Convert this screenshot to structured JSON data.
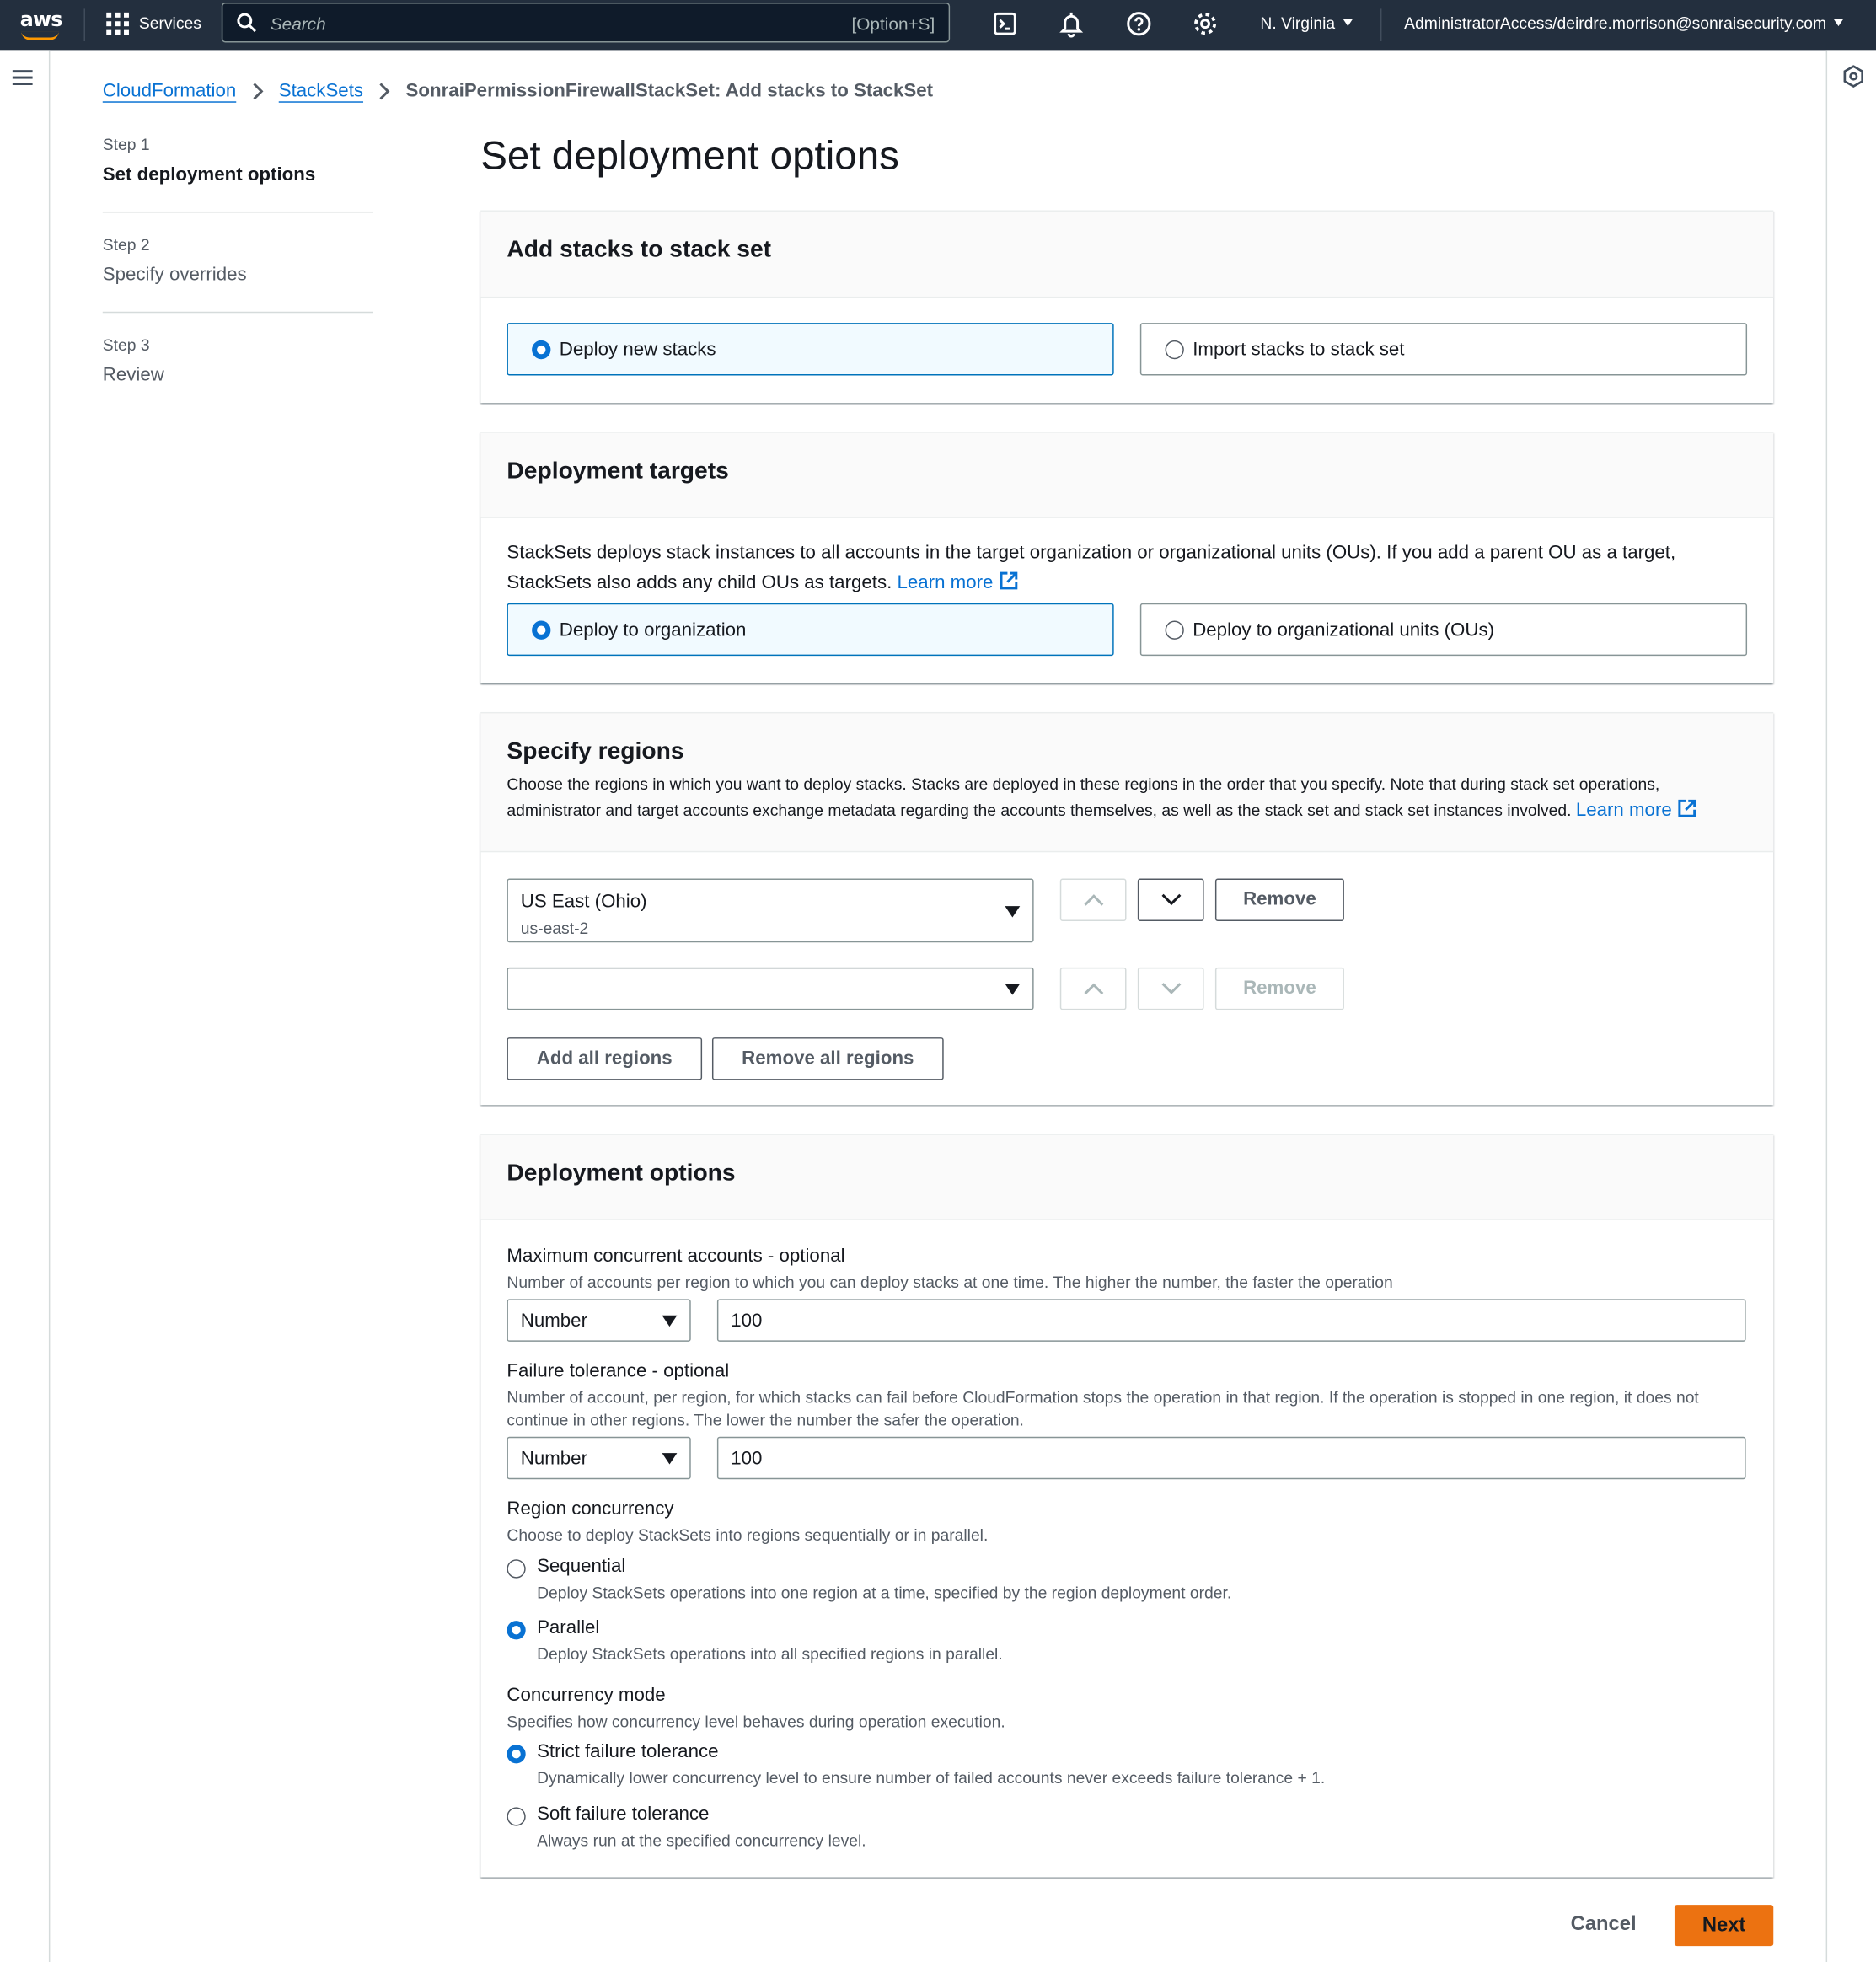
{
  "topnav": {
    "logo_text": "aws",
    "services_label": "Services",
    "search_placeholder": "Search",
    "search_shortcut": "[Option+S]",
    "region": "N. Virginia",
    "user": "AdministratorAccess/deirdre.morrison@sonraisecurity.com",
    "icons": [
      "cloudshell-icon",
      "bell-icon",
      "help-icon",
      "settings-icon"
    ],
    "accent_color": "#ff9900",
    "bg_color": "#232f3e"
  },
  "breadcrumb": {
    "items": [
      "CloudFormation",
      "StackSets"
    ],
    "current": "SonraiPermissionFirewallStackSet: Add stacks to StackSet"
  },
  "steps": [
    {
      "num": "Step 1",
      "name": "Set deployment options",
      "active": true
    },
    {
      "num": "Step 2",
      "name": "Specify overrides",
      "active": false
    },
    {
      "num": "Step 3",
      "name": "Review",
      "active": false
    }
  ],
  "page_title": "Set deployment options",
  "add_stacks": {
    "title": "Add stacks to stack set",
    "options": [
      "Deploy new stacks",
      "Import stacks to stack set"
    ],
    "selected": "Deploy new stacks"
  },
  "targets": {
    "title": "Deployment targets",
    "desc": "StackSets deploys stack instances to all accounts in the target organization or organizational units (OUs). If you add a parent OU as a target, StackSets also adds any child OUs as targets.",
    "learn_more": "Learn more",
    "options": [
      "Deploy to organization",
      "Deploy to organizational units (OUs)"
    ],
    "selected": "Deploy to organization"
  },
  "regions": {
    "title": "Specify regions",
    "desc": "Choose the regions in which you want to deploy stacks. Stacks are deployed in these regions in the order that you specify. Note that during stack set operations, administrator and target accounts exchange metadata regarding the accounts themselves, as well as the stack set and stack set instances involved.",
    "learn_more": "Learn more",
    "rows": [
      {
        "name": "US East (Ohio)",
        "code": "us-east-2",
        "remove": "Remove"
      },
      {
        "name": "",
        "code": "",
        "remove": "Remove"
      }
    ],
    "add_all": "Add all regions",
    "remove_all": "Remove all regions"
  },
  "options": {
    "title": "Deployment options",
    "max_concurrent": {
      "label": "Maximum concurrent accounts - optional",
      "desc": "Number of accounts per region to which you can deploy stacks at one time. The higher the number, the faster the operation",
      "type": "Number",
      "value": "100"
    },
    "failure_tolerance": {
      "label": "Failure tolerance - optional",
      "desc": "Number of account, per region, for which stacks can fail before CloudFormation stops the operation in that region. If the operation is stopped in one region, it does not continue in other regions. The lower the number the safer the operation.",
      "type": "Number",
      "value": "100"
    },
    "region_concurrency": {
      "label": "Region concurrency",
      "desc": "Choose to deploy StackSets into regions sequentially or in parallel.",
      "options": [
        {
          "title": "Sequential",
          "desc": "Deploy StackSets operations into one region at a time, specified by the region deployment order."
        },
        {
          "title": "Parallel",
          "desc": "Deploy StackSets operations into all specified regions in parallel."
        }
      ],
      "selected": "Parallel"
    },
    "concurrency_mode": {
      "label": "Concurrency mode",
      "desc": "Specifies how concurrency level behaves during operation execution.",
      "options": [
        {
          "title": "Strict failure tolerance",
          "desc": "Dynamically lower concurrency level to ensure number of failed accounts never exceeds failure tolerance + 1."
        },
        {
          "title": "Soft failure tolerance",
          "desc": "Always run at the specified concurrency level."
        }
      ],
      "selected": "Strict failure tolerance"
    }
  },
  "footer": {
    "cancel": "Cancel",
    "next": "Next",
    "next_color": "#ec7211"
  }
}
